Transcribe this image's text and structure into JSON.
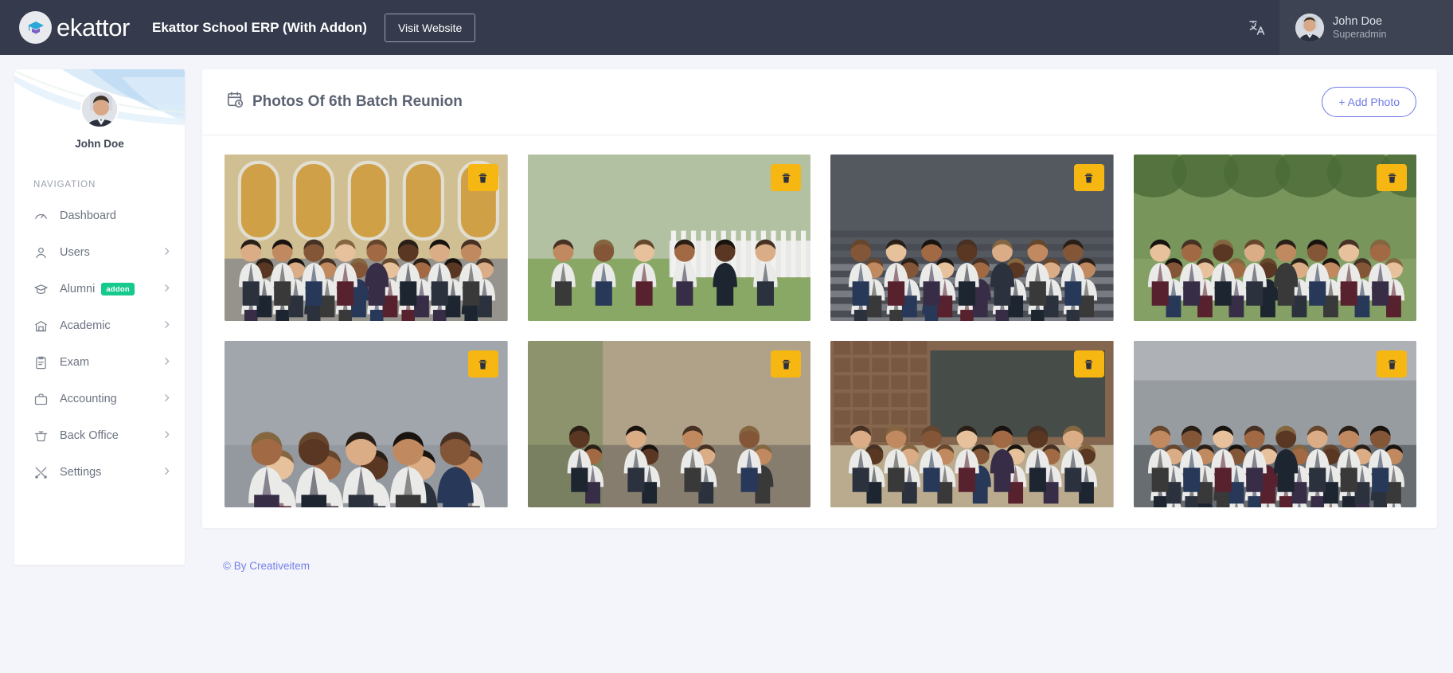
{
  "topbar": {
    "logo_icon": "graduation-cap-logo-icon",
    "logo_text": "ekattor",
    "app_title": "Ekattor School ERP (With Addon)",
    "visit_website_label": "Visit Website",
    "language_icon": "translate-icon",
    "user_name": "John Doe",
    "user_role": "Superadmin",
    "colors": {
      "bar_bg": "#353b4c",
      "user_bg": "#3d4353"
    }
  },
  "sidebar": {
    "profile_name": "John Doe",
    "nav_heading": "NAVIGATION",
    "items": [
      {
        "label": "Dashboard",
        "icon": "speedometer-icon",
        "has_chevron": false,
        "badge": ""
      },
      {
        "label": "Users",
        "icon": "user-icon",
        "has_chevron": true,
        "badge": ""
      },
      {
        "label": "Alumni",
        "icon": "graduation-cap-icon",
        "has_chevron": true,
        "badge": "addon"
      },
      {
        "label": "Academic",
        "icon": "bank-building-icon",
        "has_chevron": true,
        "badge": ""
      },
      {
        "label": "Exam",
        "icon": "clipboard-icon",
        "has_chevron": true,
        "badge": ""
      },
      {
        "label": "Accounting",
        "icon": "briefcase-icon",
        "has_chevron": true,
        "badge": ""
      },
      {
        "label": "Back Office",
        "icon": "basket-icon",
        "has_chevron": true,
        "badge": ""
      },
      {
        "label": "Settings",
        "icon": "tools-icon",
        "has_chevron": true,
        "badge": ""
      }
    ],
    "badge_color": "#16c98d"
  },
  "page": {
    "title": "Photos Of 6th Batch Reunion",
    "title_icon": "calendar-clock-icon",
    "add_photo_label": "+ Add Photo",
    "add_photo_color": "#6f7ae8"
  },
  "gallery": {
    "delete_icon": "trash-icon",
    "delete_button_color": "#f7b713",
    "photos": [
      {
        "alt": "Large group in white coats posed before arched stone building"
      },
      {
        "alt": "Students walking outdoors past a white picket fence"
      },
      {
        "alt": "Group in white coats on an indoor staircase"
      },
      {
        "alt": "Row of students in white coats outdoors among trees"
      },
      {
        "alt": "Students taking a group selfie and laughing"
      },
      {
        "alt": "Woman in white coat with crowd at an outdoor reception"
      },
      {
        "alt": "White coat ceremony in front of a chalkboard"
      },
      {
        "alt": "Auditorium audience in white coats applauding"
      }
    ]
  },
  "footer": {
    "text": "© By Creativeitem",
    "color": "#7580e8"
  }
}
